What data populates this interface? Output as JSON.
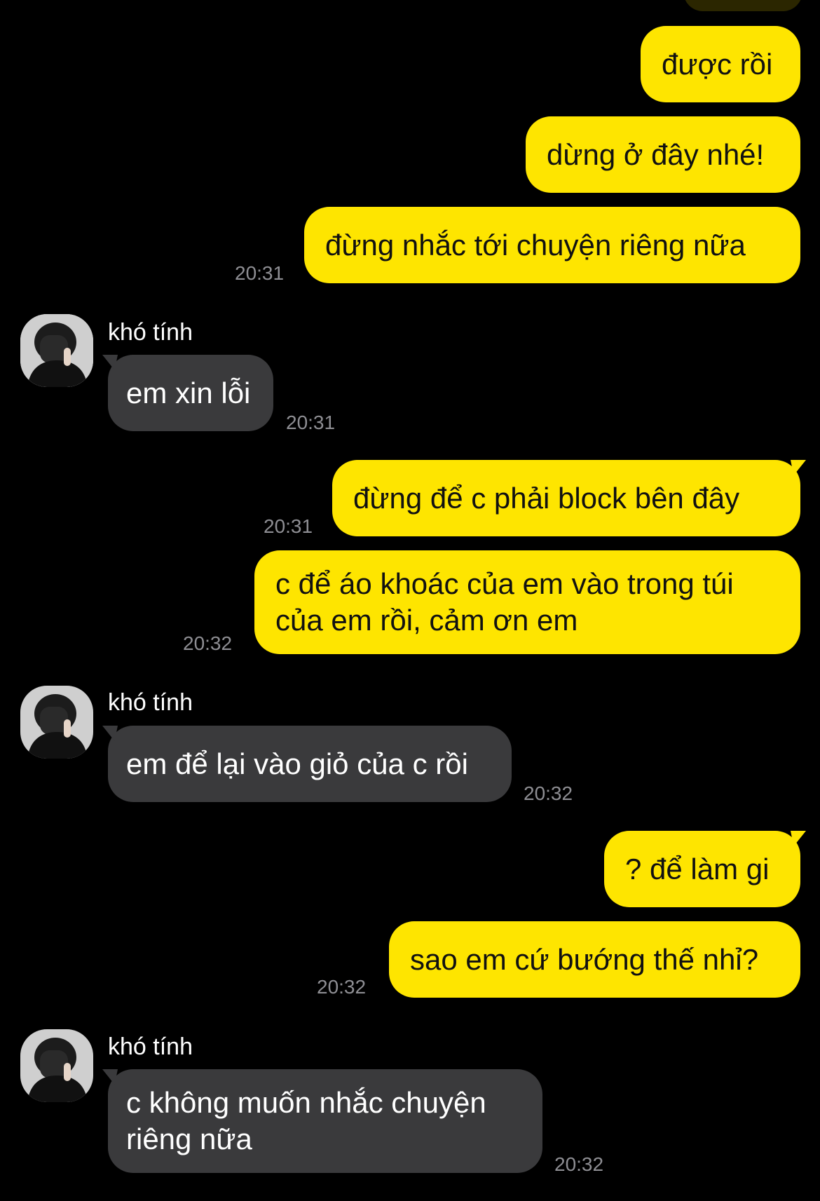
{
  "conversation": {
    "contact_name": "khó tính",
    "messages": [
      {
        "side": "out",
        "text": "được rồi",
        "time": ""
      },
      {
        "side": "out",
        "text": "dừng ở đây nhé!",
        "time": ""
      },
      {
        "side": "out",
        "text": "đừng nhắc tới chuyện riêng nữa",
        "time": "20:31"
      },
      {
        "side": "in",
        "sender": "khó tính",
        "text": "em xin lỗi",
        "time": "20:31"
      },
      {
        "side": "out",
        "text": "đừng để c phải block bên đây",
        "time": "20:31"
      },
      {
        "side": "out",
        "text_line1": "c để áo khoác của em vào trong túi",
        "text_line2": "của em rồi, cảm ơn em",
        "time": "20:32"
      },
      {
        "side": "in",
        "sender": "khó tính",
        "text": "em để lại vào giỏ của c rồi",
        "time": "20:32"
      },
      {
        "side": "out",
        "text": "? để làm gi",
        "time": ""
      },
      {
        "side": "out",
        "text": "sao em cứ bướng thế nhỉ?",
        "time": "20:32"
      },
      {
        "side": "in",
        "sender": "khó tính",
        "text_line1": "c không muốn nhắc chuyện",
        "text_line2": "riêng nữa",
        "time": "20:32"
      }
    ]
  },
  "colors": {
    "background": "#000000",
    "outgoing_bubble": "#FEE500",
    "incoming_bubble": "#3A3A3C",
    "timestamp": "#8E8E93"
  },
  "icons": {
    "avatar": "contact-avatar-photo"
  }
}
